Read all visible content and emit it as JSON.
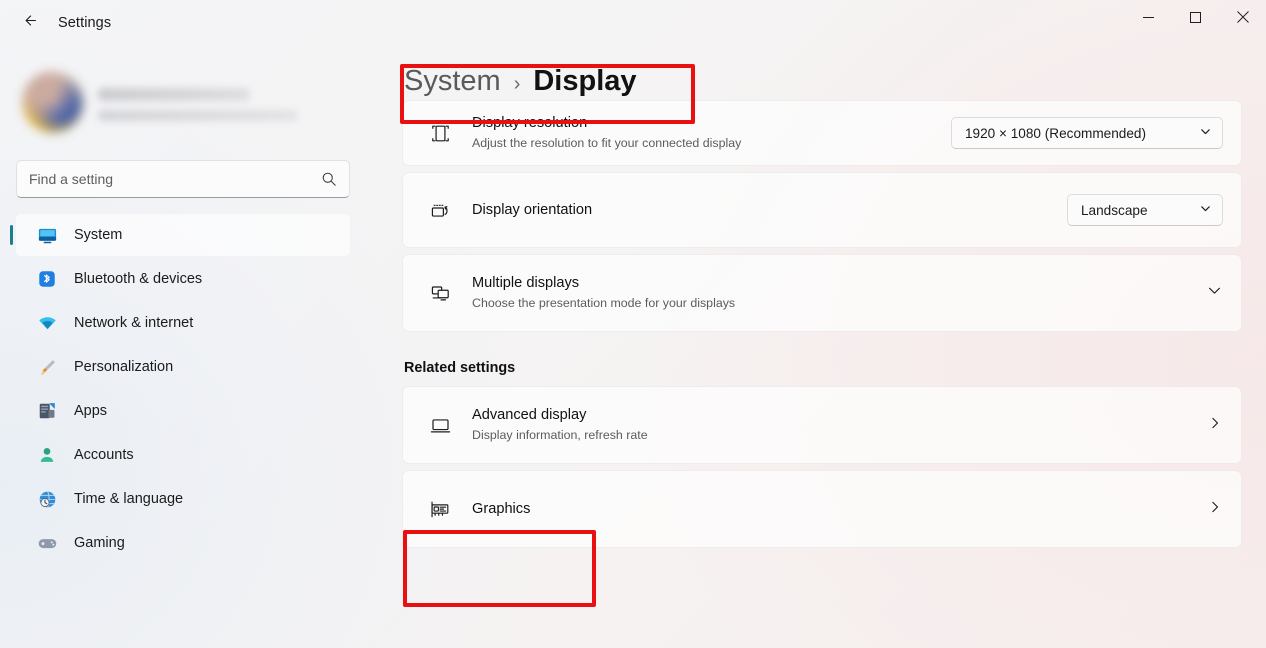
{
  "window": {
    "title": "Settings",
    "back_icon": "arrow-left-icon",
    "controls": [
      {
        "name": "minimize-button",
        "glyph": "minimize-icon"
      },
      {
        "name": "maximize-button",
        "glyph": "maximize-icon"
      },
      {
        "name": "close-button",
        "glyph": "close-icon"
      }
    ]
  },
  "sidebar": {
    "account": {
      "name_redacted": "",
      "email_redacted": "",
      "avatar_icon": "user-avatar"
    },
    "search": {
      "placeholder": "Find a setting",
      "value": "",
      "icon": "search-icon"
    },
    "items": [
      {
        "label": "System",
        "icon": "monitor-icon",
        "selected": true
      },
      {
        "label": "Bluetooth & devices",
        "icon": "bluetooth-icon",
        "selected": false
      },
      {
        "label": "Network & internet",
        "icon": "wifi-icon",
        "selected": false
      },
      {
        "label": "Personalization",
        "icon": "brush-icon",
        "selected": false
      },
      {
        "label": "Apps",
        "icon": "apps-icon",
        "selected": false
      },
      {
        "label": "Accounts",
        "icon": "person-icon",
        "selected": false
      },
      {
        "label": "Time & language",
        "icon": "clock-globe-icon",
        "selected": false
      },
      {
        "label": "Gaming",
        "icon": "gamepad-icon",
        "selected": false
      }
    ]
  },
  "content": {
    "breadcrumb": {
      "parent": "System",
      "separator": "›",
      "current": "Display"
    },
    "settings": [
      {
        "title": "Display resolution",
        "subtitle": "Adjust the resolution to fit your connected display",
        "icon": "resolution-icon",
        "control": "dropdown",
        "value": "1920 × 1080 (Recommended)"
      },
      {
        "title": "Display orientation",
        "subtitle": "",
        "icon": "orientation-icon",
        "control": "dropdown",
        "value": "Landscape"
      },
      {
        "title": "Multiple displays",
        "subtitle": "Choose the presentation mode for your displays",
        "icon": "multiple-displays-icon",
        "control": "expander",
        "value": ""
      }
    ],
    "related_settings": {
      "heading": "Related settings",
      "items": [
        {
          "title": "Advanced display",
          "subtitle": "Display information, refresh rate",
          "icon": "advanced-display-icon",
          "control": "navigate"
        },
        {
          "title": "Graphics",
          "subtitle": "",
          "icon": "graphics-card-icon",
          "control": "navigate"
        }
      ]
    }
  },
  "annotations": {
    "accent_color": "#e81010",
    "boxes": [
      {
        "name": "breadcrumb-highlight",
        "target": "System > Display"
      },
      {
        "name": "graphics-highlight",
        "target": "Graphics"
      }
    ]
  }
}
